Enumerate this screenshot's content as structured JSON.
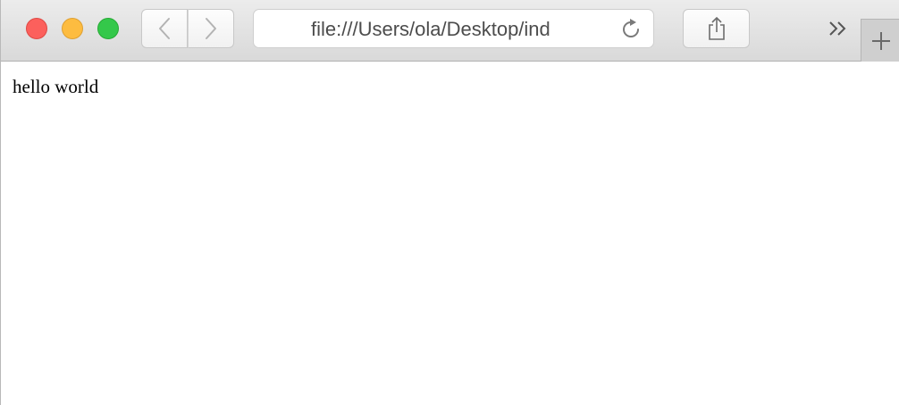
{
  "window": {
    "traffic_lights": {
      "close": {
        "icon": "close-traffic-light",
        "color": "#fc605c"
      },
      "minimize": {
        "icon": "minimize-traffic-light",
        "color": "#fdbc40"
      },
      "zoom": {
        "icon": "zoom-traffic-light",
        "color": "#34c84a"
      }
    }
  },
  "toolbar": {
    "back": {
      "icon": "chevron-left-icon"
    },
    "forward": {
      "icon": "chevron-right-icon"
    },
    "address": {
      "url": "file:///Users/ola/Desktop/ind",
      "reload_icon": "reload-icon"
    },
    "share": {
      "icon": "share-icon"
    },
    "more": {
      "icon": "double-chevron-right-icon"
    },
    "new_tab": {
      "icon": "plus-icon"
    }
  },
  "content": {
    "text": "hello world"
  }
}
